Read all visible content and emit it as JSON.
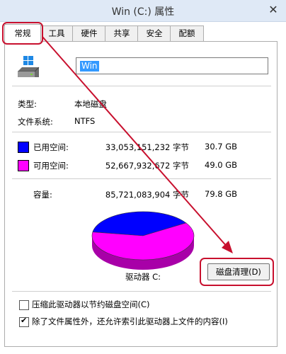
{
  "window": {
    "title": "Win (C:) 属性",
    "close_glyph": "✕"
  },
  "tabs": [
    {
      "label": "常规",
      "active": true
    },
    {
      "label": "工具"
    },
    {
      "label": "硬件"
    },
    {
      "label": "共享"
    },
    {
      "label": "安全"
    },
    {
      "label": "配额"
    }
  ],
  "general": {
    "drive_name": "Win",
    "type_label": "类型:",
    "type_value": "本地磁盘",
    "fs_label": "文件系统:",
    "fs_value": "NTFS",
    "used": {
      "label": "已用空间:",
      "bytes": "33,053,151,232 字节",
      "gb": "30.7 GB",
      "color": "#0000ff"
    },
    "free": {
      "label": "可用空间:",
      "bytes": "52,667,932,672 字节",
      "gb": "49.0 GB",
      "color": "#ff00ff"
    },
    "capacity": {
      "label": "容量:",
      "bytes": "85,721,083,904 字节",
      "gb": "79.8 GB"
    },
    "drive_label": "驱动器 C:",
    "cleanup_button": "磁盘清理(D)",
    "compress_option": {
      "label": "压缩此驱动器以节约磁盘空间(C)",
      "checked": false
    },
    "index_option": {
      "label": "除了文件属性外，还允许索引此驱动器上文件的内容(I)",
      "checked": true
    }
  },
  "chart_data": {
    "type": "pie",
    "categories": [
      "已用空间",
      "可用空间"
    ],
    "values": [
      30.7,
      49.0
    ],
    "colors": [
      "#0000ff",
      "#ff00ff"
    ]
  },
  "annotation_color": "#c8102e"
}
